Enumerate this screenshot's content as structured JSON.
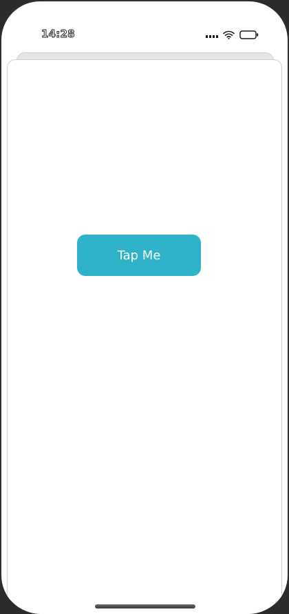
{
  "status_bar": {
    "time": "14:28",
    "icons": [
      "signal-icon",
      "wifi-icon",
      "battery-icon"
    ]
  },
  "main": {
    "button_label": "Tap Me",
    "button_color": "#2fb2c8"
  }
}
